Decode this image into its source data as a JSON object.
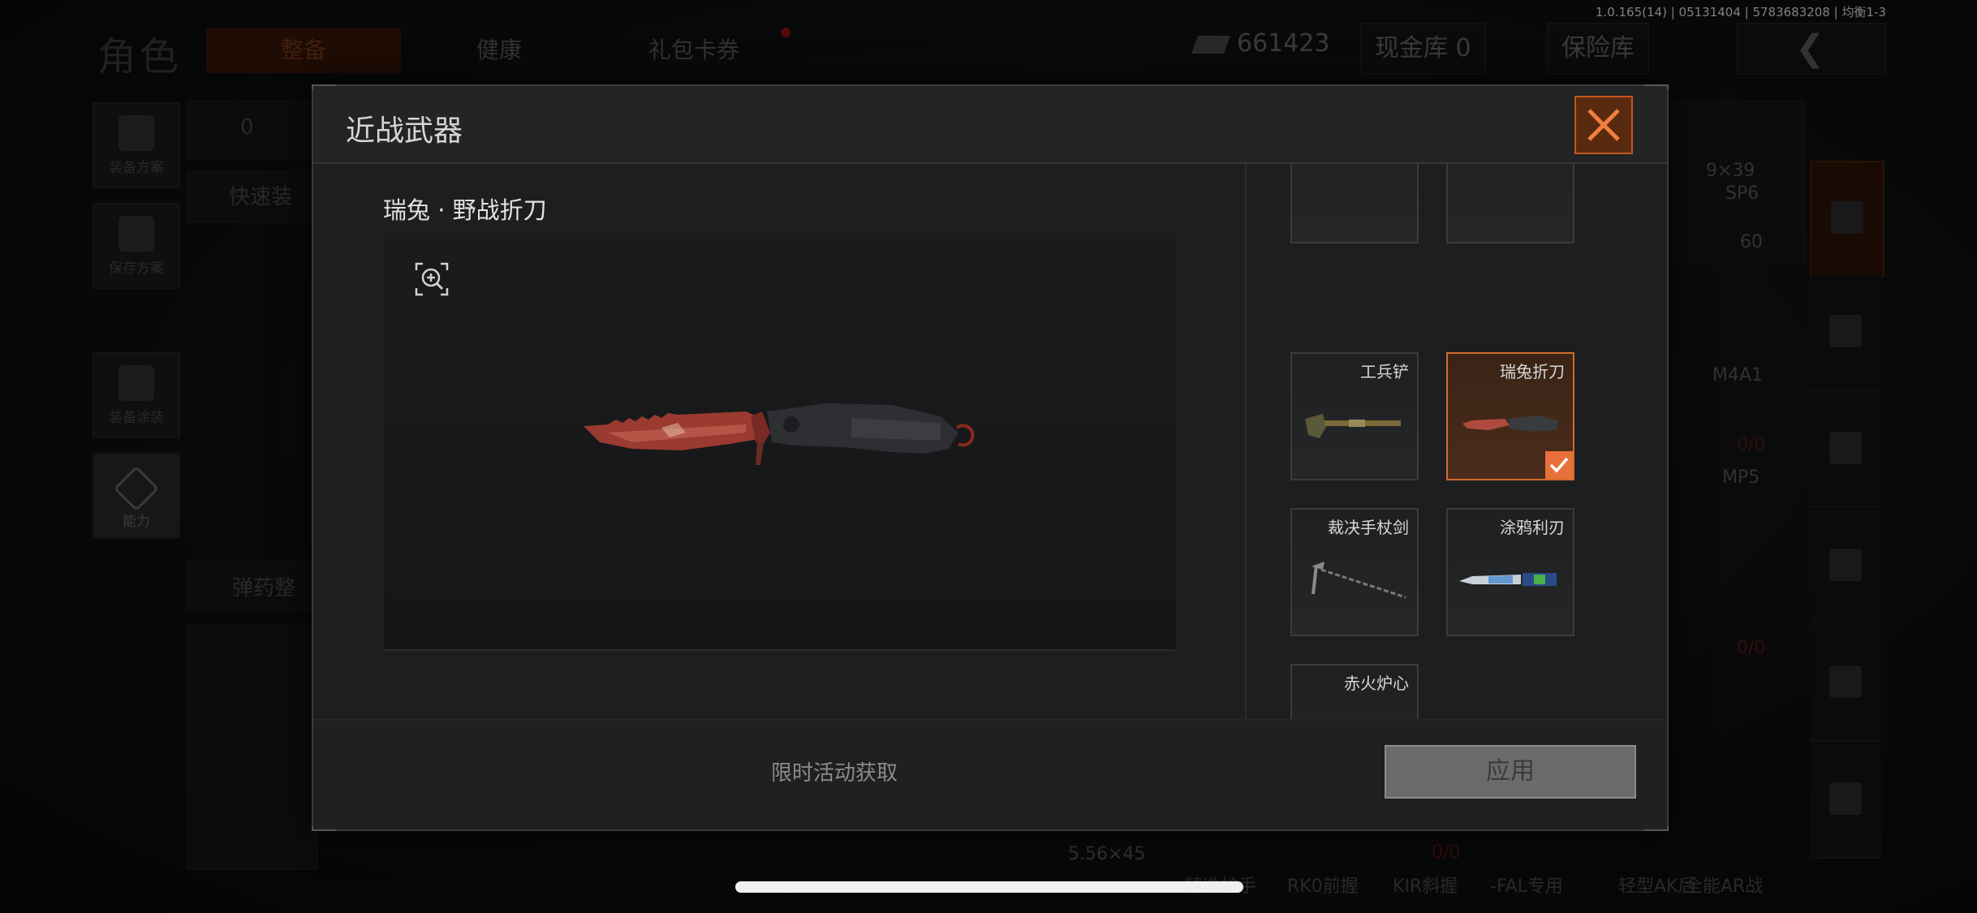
{
  "status": {
    "build": "1.0.165(14) | 05131404 | 5783683208 | 均衡1-3"
  },
  "background": {
    "page_title": "角色",
    "tabs": [
      {
        "label": "整备"
      },
      {
        "label": "健康"
      },
      {
        "label": "礼包卡券"
      }
    ],
    "currency_value": "661423",
    "vault_label": "现金库 0",
    "insurance_label": "保险库",
    "left_buttons": [
      {
        "label": "装备方案"
      },
      {
        "label": "保存方案"
      },
      {
        "label": "装备涂装"
      },
      {
        "label": "能力"
      }
    ],
    "top_count": "0",
    "quick_equip": "快速装",
    "ammo_label": "弹药整",
    "right_texts": {
      "caliber_top": "9×39",
      "sp6": "SP6",
      "sp6_count": "60",
      "m4a1": "M4A1",
      "m4a1_ammo": "0/0",
      "mp5": "MP5",
      "mp5_ammo": "0/0",
      "caliber_bottom": "5.56×45",
      "caliber_bottom_ammo": "0/0"
    },
    "bottom_tags": [
      "精准护手",
      "RK0前握",
      "KIR斜握",
      "-FAL专用",
      "轻型AK后",
      "全能AR战"
    ]
  },
  "modal": {
    "title": "近战武器",
    "selected_item_name": "瑞兔 · 野战折刀",
    "zoom_icon": "zoom-in-icon",
    "items": [
      {
        "name": "",
        "selected": false
      },
      {
        "name": "",
        "selected": false
      },
      {
        "name": "工兵铲",
        "icon": "shovel-icon",
        "selected": false
      },
      {
        "name": "瑞兔折刀",
        "icon": "folding-knife-icon",
        "selected": true
      },
      {
        "name": "裁决手杖剑",
        "icon": "cane-sword-icon",
        "selected": false
      },
      {
        "name": "涂鸦利刃",
        "icon": "graffiti-blade-icon",
        "selected": false
      },
      {
        "name": "赤火炉心",
        "icon": "twin-blades-icon",
        "selected": false
      }
    ],
    "source_text": "限时活动获取",
    "apply_label": "应用",
    "accent_color": "#e8703a"
  }
}
